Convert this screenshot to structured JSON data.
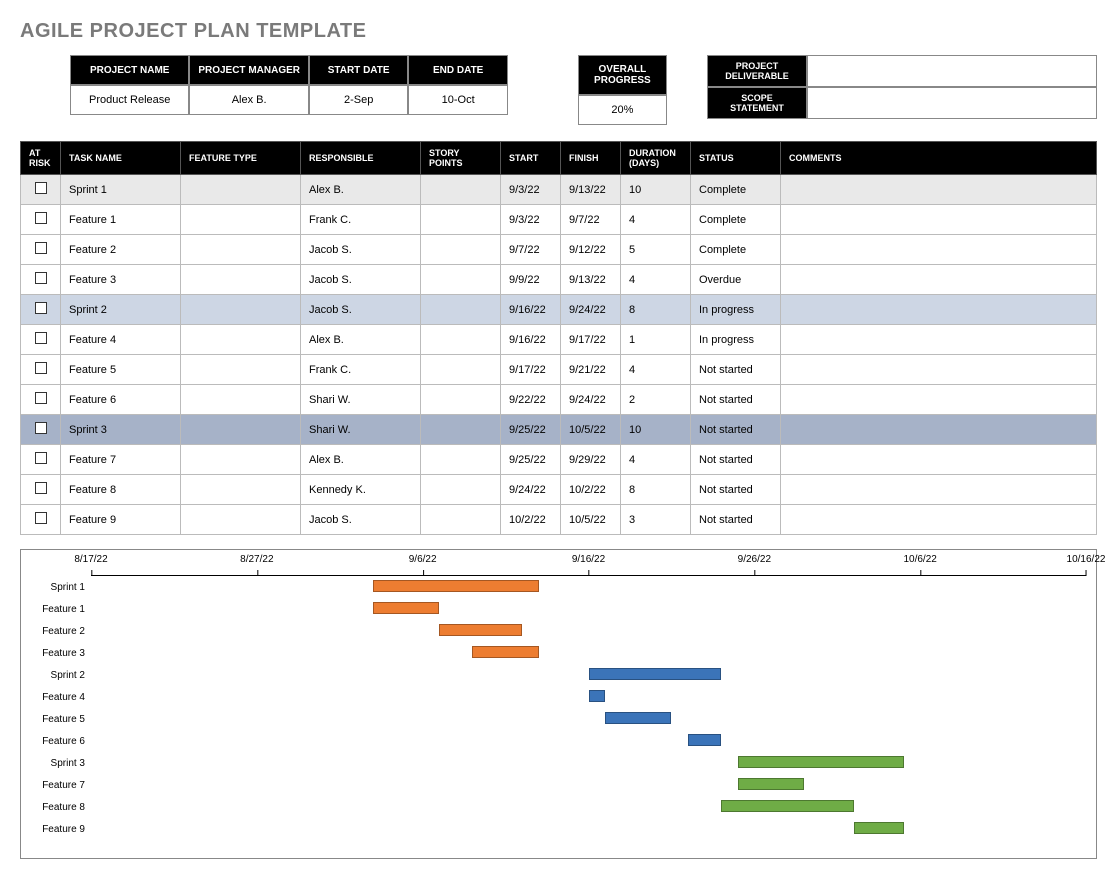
{
  "title": "AGILE PROJECT PLAN TEMPLATE",
  "header": {
    "project_name_label": "PROJECT NAME",
    "project_name": "Product Release",
    "project_manager_label": "PROJECT MANAGER",
    "project_manager": "Alex B.",
    "start_date_label": "START DATE",
    "start_date": "2-Sep",
    "end_date_label": "END DATE",
    "end_date": "10-Oct",
    "overall_progress_label": "OVERALL PROGRESS",
    "overall_progress": "20%",
    "project_deliverable_label": "PROJECT DELIVERABLE",
    "project_deliverable": "",
    "scope_statement_label": "SCOPE STATEMENT",
    "scope_statement": ""
  },
  "columns": {
    "at_risk": "AT RISK",
    "task_name": "TASK NAME",
    "feature_type": "FEATURE TYPE",
    "responsible": "RESPONSIBLE",
    "story_points": "STORY POINTS",
    "start": "START",
    "finish": "FINISH",
    "duration": "DURATION (DAYS)",
    "status": "STATUS",
    "comments": "COMMENTS"
  },
  "rows": [
    {
      "task": "Sprint 1",
      "ft": "",
      "resp": "Alex B.",
      "sp": "",
      "start": "9/3/22",
      "finish": "9/13/22",
      "dur": "10",
      "status": "Complete",
      "shade": "grey"
    },
    {
      "task": "Feature 1",
      "ft": "",
      "resp": "Frank C.",
      "sp": "",
      "start": "9/3/22",
      "finish": "9/7/22",
      "dur": "4",
      "status": "Complete",
      "shade": ""
    },
    {
      "task": "Feature 2",
      "ft": "",
      "resp": "Jacob S.",
      "sp": "",
      "start": "9/7/22",
      "finish": "9/12/22",
      "dur": "5",
      "status": "Complete",
      "shade": ""
    },
    {
      "task": "Feature 3",
      "ft": "",
      "resp": "Jacob S.",
      "sp": "",
      "start": "9/9/22",
      "finish": "9/13/22",
      "dur": "4",
      "status": "Overdue",
      "shade": ""
    },
    {
      "task": "Sprint 2",
      "ft": "",
      "resp": "Jacob S.",
      "sp": "",
      "start": "9/16/22",
      "finish": "9/24/22",
      "dur": "8",
      "status": "In progress",
      "shade": "blue1"
    },
    {
      "task": "Feature 4",
      "ft": "",
      "resp": "Alex B.",
      "sp": "",
      "start": "9/16/22",
      "finish": "9/17/22",
      "dur": "1",
      "status": "In progress",
      "shade": ""
    },
    {
      "task": "Feature 5",
      "ft": "",
      "resp": "Frank C.",
      "sp": "",
      "start": "9/17/22",
      "finish": "9/21/22",
      "dur": "4",
      "status": "Not started",
      "shade": ""
    },
    {
      "task": "Feature 6",
      "ft": "",
      "resp": "Shari W.",
      "sp": "",
      "start": "9/22/22",
      "finish": "9/24/22",
      "dur": "2",
      "status": "Not started",
      "shade": ""
    },
    {
      "task": "Sprint 3",
      "ft": "",
      "resp": "Shari W.",
      "sp": "",
      "start": "9/25/22",
      "finish": "10/5/22",
      "dur": "10",
      "status": "Not started",
      "shade": "blue2"
    },
    {
      "task": "Feature 7",
      "ft": "",
      "resp": "Alex B.",
      "sp": "",
      "start": "9/25/22",
      "finish": "9/29/22",
      "dur": "4",
      "status": "Not started",
      "shade": ""
    },
    {
      "task": "Feature 8",
      "ft": "",
      "resp": "Kennedy K.",
      "sp": "",
      "start": "9/24/22",
      "finish": "10/2/22",
      "dur": "8",
      "status": "Not started",
      "shade": ""
    },
    {
      "task": "Feature 9",
      "ft": "",
      "resp": "Jacob S.",
      "sp": "",
      "start": "10/2/22",
      "finish": "10/5/22",
      "dur": "3",
      "status": "Not started",
      "shade": ""
    }
  ],
  "chart_data": {
    "type": "gantt",
    "x_axis_ticks": [
      "8/17/22",
      "8/27/22",
      "9/6/22",
      "9/16/22",
      "9/26/22",
      "10/6/22",
      "10/16/22"
    ],
    "x_min": "8/17/22",
    "x_max": "10/16/22",
    "series": [
      {
        "name": "Sprint 1",
        "start": "9/3/22",
        "end": "9/13/22",
        "color": "orange"
      },
      {
        "name": "Feature 1",
        "start": "9/3/22",
        "end": "9/7/22",
        "color": "orange"
      },
      {
        "name": "Feature 2",
        "start": "9/7/22",
        "end": "9/12/22",
        "color": "orange"
      },
      {
        "name": "Feature 3",
        "start": "9/9/22",
        "end": "9/13/22",
        "color": "orange"
      },
      {
        "name": "Sprint 2",
        "start": "9/16/22",
        "end": "9/24/22",
        "color": "blue"
      },
      {
        "name": "Feature 4",
        "start": "9/16/22",
        "end": "9/17/22",
        "color": "blue"
      },
      {
        "name": "Feature 5",
        "start": "9/17/22",
        "end": "9/21/22",
        "color": "blue"
      },
      {
        "name": "Feature 6",
        "start": "9/22/22",
        "end": "9/24/22",
        "color": "blue"
      },
      {
        "name": "Sprint 3",
        "start": "9/25/22",
        "end": "10/5/22",
        "color": "green"
      },
      {
        "name": "Feature 7",
        "start": "9/25/22",
        "end": "9/29/22",
        "color": "green"
      },
      {
        "name": "Feature 8",
        "start": "9/24/22",
        "end": "10/2/22",
        "color": "green"
      },
      {
        "name": "Feature 9",
        "start": "10/2/22",
        "end": "10/5/22",
        "color": "green"
      }
    ]
  }
}
